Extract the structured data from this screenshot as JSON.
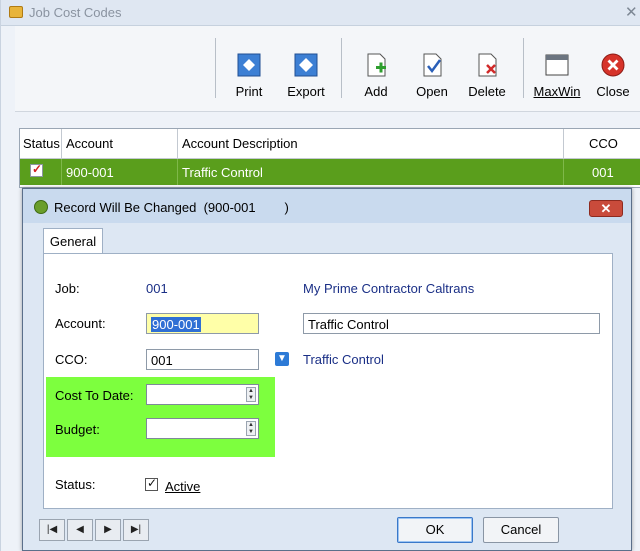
{
  "window": {
    "title": "Job Cost Codes",
    "close_glyph": "✕"
  },
  "toolbar": {
    "print": "Print",
    "export": "Export",
    "add": "Add",
    "open": "Open",
    "delete": "Delete",
    "maxwin": "MaxWin",
    "close": "Close"
  },
  "grid": {
    "headers": {
      "status": "Status",
      "account": "Account",
      "description": "Account Description",
      "cco": "CCO"
    },
    "row": {
      "account": "900-001",
      "description": "Traffic Control",
      "cco": "001"
    }
  },
  "dialog": {
    "title": "Record Will Be Changed  (900-001        )",
    "close_glyph": "✕",
    "tab": "General",
    "job_label": "Job:",
    "job_value": "001",
    "job_desc": "My Prime Contractor Caltrans",
    "account_label": "Account:",
    "account_value": "900-001",
    "account_desc": "Traffic Control",
    "cco_label": "CCO:",
    "cco_value": "001",
    "cco_desc": "Traffic Control",
    "cost_label": "Cost To Date:",
    "cost_value": "",
    "budget_label": "Budget:",
    "budget_value": "",
    "status_label": "Status:",
    "active_label": "Active",
    "ok": "OK",
    "cancel": "Cancel"
  },
  "colors": {
    "highlight_row": "#5a9e1c",
    "green_zone": "#7dff3e",
    "link_blue": "#1a2f86"
  }
}
